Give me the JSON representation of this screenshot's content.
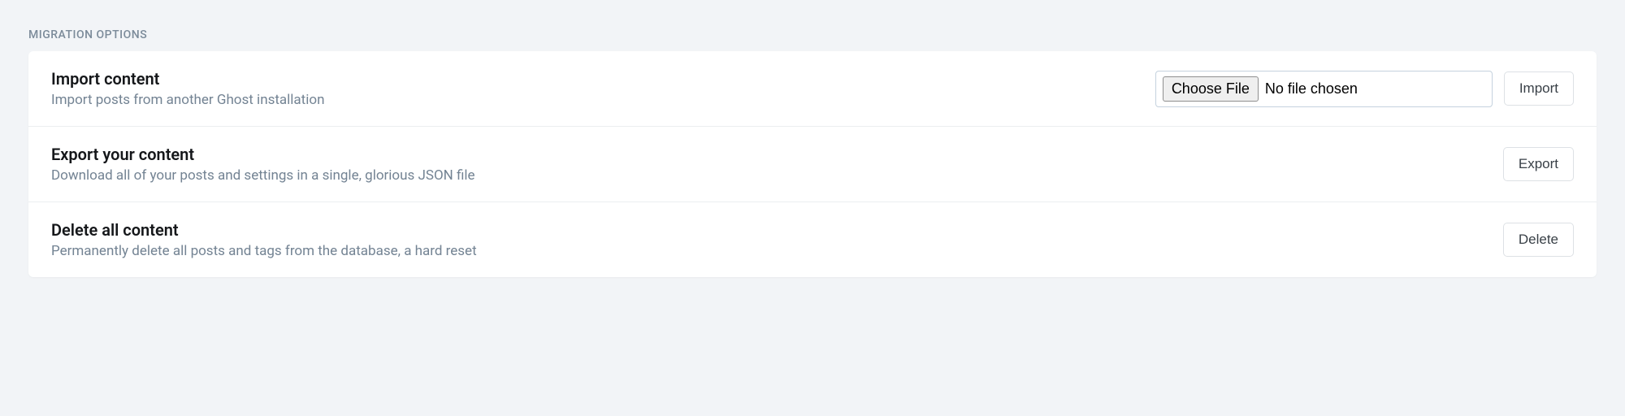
{
  "section_header": "MIGRATION OPTIONS",
  "rows": {
    "import": {
      "title": "Import content",
      "desc": "Import posts from another Ghost installation",
      "choose_file_label": "Choose File",
      "file_status": "No file chosen",
      "button_label": "Import"
    },
    "export": {
      "title": "Export your content",
      "desc": "Download all of your posts and settings in a single, glorious JSON file",
      "button_label": "Export"
    },
    "delete": {
      "title": "Delete all content",
      "desc": "Permanently delete all posts and tags from the database, a hard reset",
      "button_label": "Delete"
    }
  }
}
